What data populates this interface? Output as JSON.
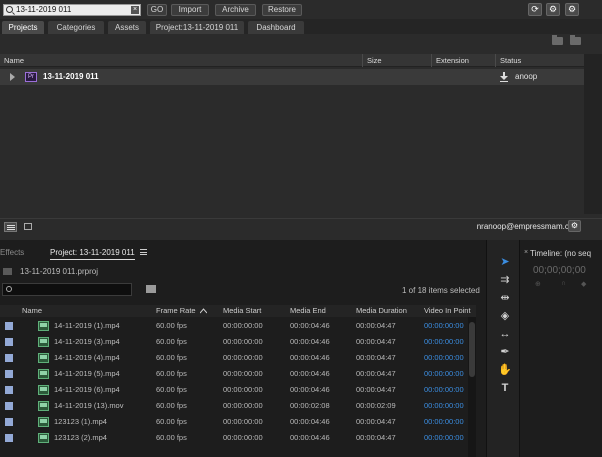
{
  "top_bar": {
    "search_value": "13-11-2019 011",
    "buttons": {
      "go": "GO",
      "import": "Import",
      "archive": "Archive",
      "restore": "Restore"
    },
    "icons": [
      "refresh-icon",
      "gear-icon",
      "settings-icon"
    ]
  },
  "tabs": [
    {
      "label": "Projects",
      "active": true
    },
    {
      "label": "Categories"
    },
    {
      "label": "Assets"
    },
    {
      "label": "Project:13-11-2019 011"
    },
    {
      "label": "Dashboard"
    }
  ],
  "file_table": {
    "headers": {
      "name": "Name",
      "size": "Size",
      "extension": "Extension",
      "status": "Status"
    },
    "rows": [
      {
        "badge": "Pr",
        "name": "13-11-2019 011",
        "size": "",
        "extension": "",
        "status": "anoop"
      }
    ]
  },
  "footer": {
    "email": "nranoop@empressmam.com"
  },
  "project_panel": {
    "effects_tab": "Effects",
    "project_tab": "Project: 13-11-2019 011",
    "project_file": "13-11-2019 011.prproj",
    "selection_count": "1 of 18 items selected",
    "headers": {
      "name": "Name",
      "frame_rate": "Frame Rate",
      "media_start": "Media Start",
      "media_end": "Media End",
      "media_duration": "Media Duration",
      "video_in_point": "Video In Point"
    },
    "rows": [
      {
        "name": "14-11-2019 (1).mp4",
        "fps": "60.00 fps",
        "start": "00:00:00:00",
        "end": "00:00:04:46",
        "duration": "00:00:04:47",
        "in_point": "00:00:00:00"
      },
      {
        "name": "14-11-2019 (3).mp4",
        "fps": "60.00 fps",
        "start": "00:00:00:00",
        "end": "00:00:04:46",
        "duration": "00:00:04:47",
        "in_point": "00:00:00:00"
      },
      {
        "name": "14-11-2019 (4).mp4",
        "fps": "60.00 fps",
        "start": "00:00:00:00",
        "end": "00:00:04:46",
        "duration": "00:00:04:47",
        "in_point": "00:00:00:00"
      },
      {
        "name": "14-11-2019 (5).mp4",
        "fps": "60.00 fps",
        "start": "00:00:00:00",
        "end": "00:00:04:46",
        "duration": "00:00:04:47",
        "in_point": "00:00:00:00"
      },
      {
        "name": "14-11-2019 (6).mp4",
        "fps": "60.00 fps",
        "start": "00:00:00:00",
        "end": "00:00:04:46",
        "duration": "00:00:04:47",
        "in_point": "00:00:00:00"
      },
      {
        "name": "14-11-2019 (13).mov",
        "fps": "60.00 fps",
        "start": "00:00:00:00",
        "end": "00:00:02:08",
        "duration": "00:00:02:09",
        "in_point": "00:00:00:00"
      },
      {
        "name": "123123 (1).mp4",
        "fps": "60.00 fps",
        "start": "00:00:00:00",
        "end": "00:00:04:46",
        "duration": "00:00:04:47",
        "in_point": "00:00:00:00"
      },
      {
        "name": "123123 (2).mp4",
        "fps": "60.00 fps",
        "start": "00:00:00:00",
        "end": "00:00:04:46",
        "duration": "00:00:04:47",
        "in_point": "00:00:00:00"
      }
    ]
  },
  "tools": [
    "selection-tool-icon",
    "track-select-icon",
    "ripple-edit-icon",
    "razor-icon",
    "slip-icon",
    "pen-icon",
    "hand-icon",
    "type-icon"
  ],
  "timeline": {
    "title": "Timeline: (no seq",
    "timecode": "00;00;00;00"
  }
}
